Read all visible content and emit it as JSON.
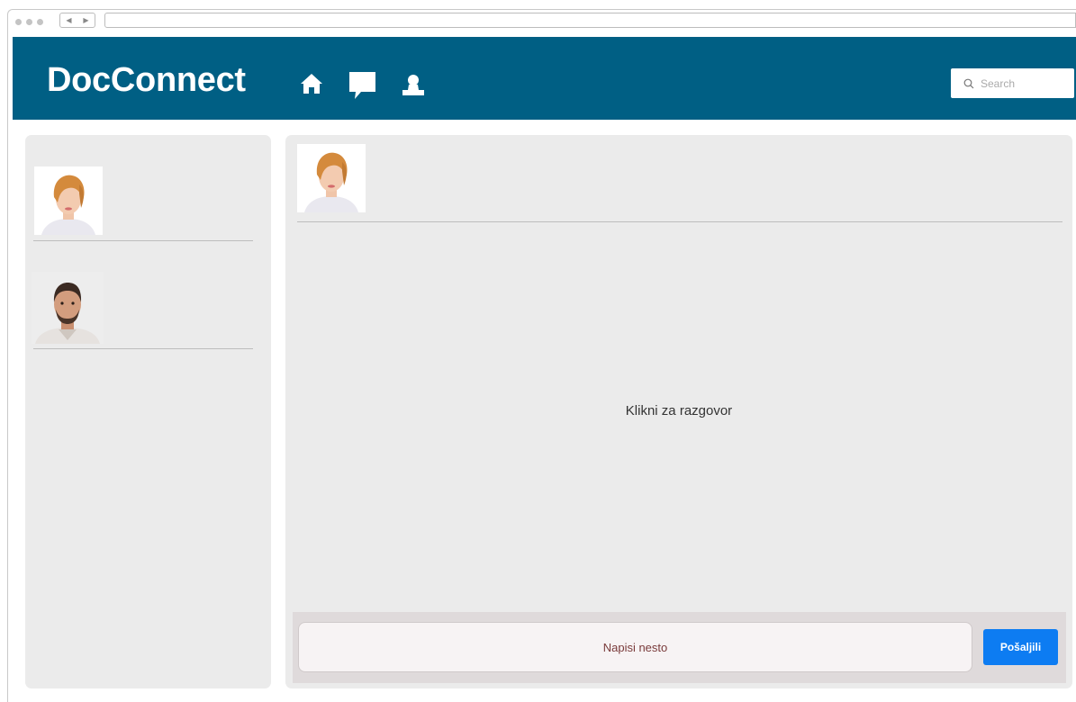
{
  "header": {
    "brand": "DocConnect",
    "nav_icons": [
      "home-icon",
      "chat-icon",
      "user-icon"
    ],
    "search": {
      "placeholder": "Search",
      "value": ""
    },
    "background_color": "#005f84"
  },
  "sidebar": {
    "contacts": [
      {
        "avatar": "woman-portrait"
      },
      {
        "avatar": "man-portrait"
      }
    ]
  },
  "chat": {
    "active_avatar": "woman-portrait",
    "empty_text": "Klikni za razgovor",
    "composer": {
      "placeholder": "Napisi nesto",
      "value": "",
      "send_label": "Pošaljili",
      "send_color": "#0d7cf2"
    }
  }
}
